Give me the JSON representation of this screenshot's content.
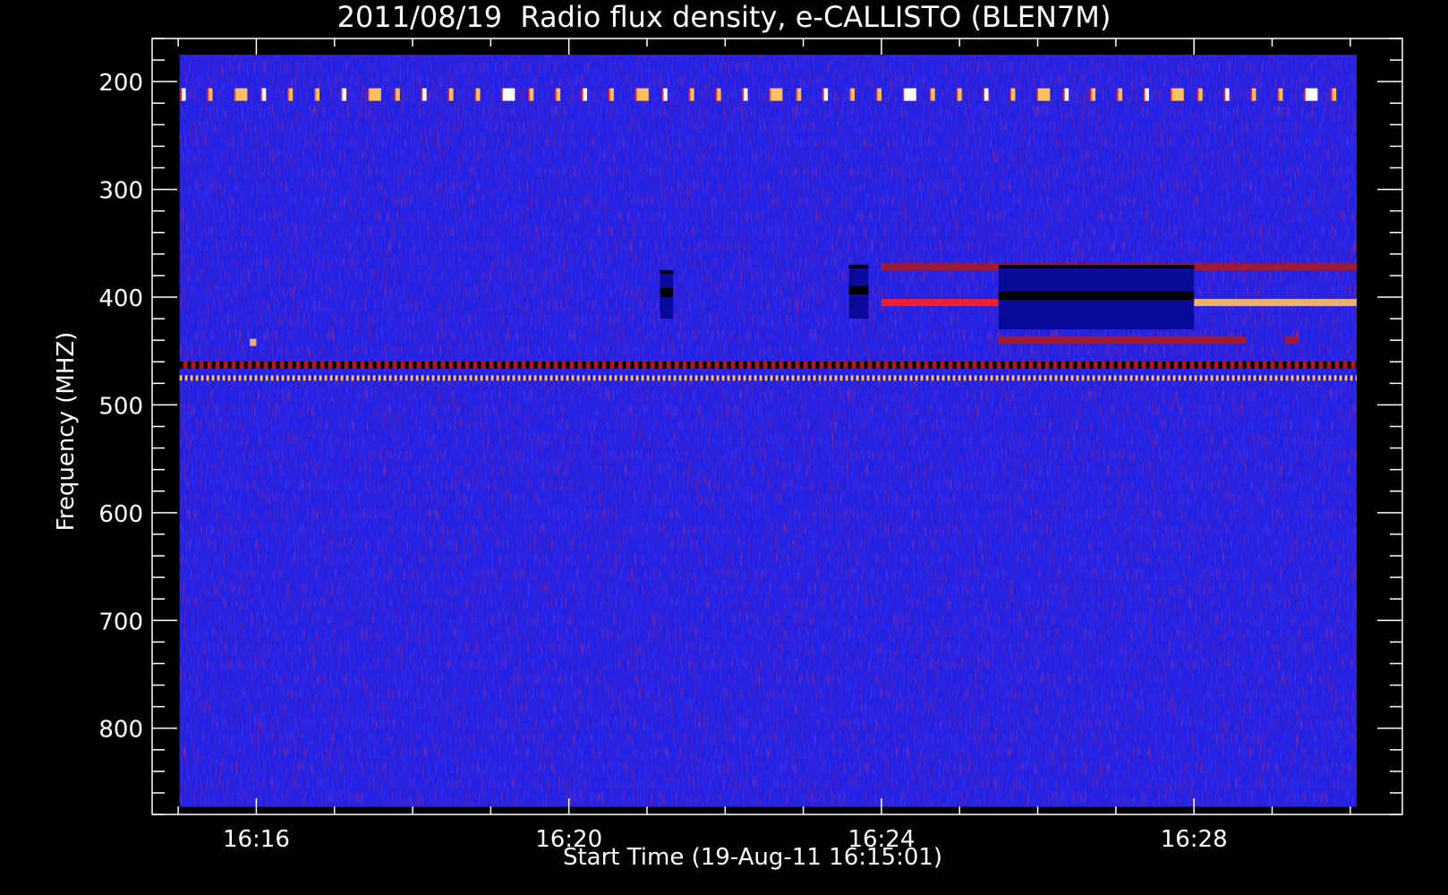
{
  "chart_data": {
    "type": "heatmap",
    "title": "2011/08/19  Radio flux density, e-CALLISTO (BLEN7M)",
    "xlabel": "Start Time (19-Aug-11 16:15:01)",
    "ylabel": "Frequency (MHZ)",
    "x_unit": "minutes",
    "x_range": [
      "16:14:40",
      "16:30:40"
    ],
    "data_x_range": [
      "16:15:01",
      "16:30:05"
    ],
    "y_range": [
      160,
      880
    ],
    "data_y_range": [
      175,
      873
    ],
    "y_reversed": true,
    "x_ticks": [
      "16:16",
      "16:20",
      "16:24",
      "16:28"
    ],
    "y_ticks": [
      200,
      300,
      400,
      500,
      600,
      700,
      800
    ],
    "colormap": [
      "#000000",
      "#1010c8",
      "#2828ff",
      "#b01818",
      "#ff2020",
      "#ffc060",
      "#ffffff"
    ],
    "background_value": "low (blue)",
    "features": [
      {
        "name": "periodic interference",
        "freq_mhz": 212,
        "level": "high",
        "start": "16:15:01",
        "end": "16:30:05",
        "pattern": "pulses about every 20 s"
      },
      {
        "name": "interference band",
        "freq_mhz": 463,
        "level": "dark/high mixed",
        "start": "16:15:01",
        "end": "16:30:05"
      },
      {
        "name": "interference band",
        "freq_mhz": 475,
        "level": "high",
        "start": "16:15:01",
        "end": "16:30:05",
        "pattern": "dotted"
      },
      {
        "name": "emission",
        "freq_mhz": 405,
        "level": "medium-high",
        "start": "16:24:00",
        "end": "16:25:30"
      },
      {
        "name": "emission",
        "freq_mhz": 405,
        "level": "high",
        "start": "16:28:00",
        "end": "16:30:05"
      },
      {
        "name": "emission",
        "freq_mhz": 372,
        "level": "medium",
        "start": "16:24:00",
        "end": "16:30:05"
      },
      {
        "name": "emission",
        "freq_mhz": 440,
        "level": "medium",
        "start": "16:25:30",
        "end": "16:28:40"
      },
      {
        "name": "dropout",
        "freq_mhz_range": [
          370,
          430
        ],
        "level": "low",
        "start": "16:25:30",
        "end": "16:28:00"
      },
      {
        "name": "dropout",
        "freq_mhz_range": [
          370,
          420
        ],
        "level": "low",
        "start": "16:23:35",
        "end": "16:23:50"
      },
      {
        "name": "dropout",
        "freq_mhz_range": [
          375,
          420
        ],
        "level": "low",
        "start": "16:21:10",
        "end": "16:21:20"
      },
      {
        "name": "spot",
        "freq_mhz": 442,
        "level": "high",
        "start": "16:15:55",
        "end": "16:16:00"
      },
      {
        "name": "spot",
        "freq_mhz": 440,
        "level": "medium",
        "start": "16:29:10",
        "end": "16:29:20"
      }
    ]
  }
}
